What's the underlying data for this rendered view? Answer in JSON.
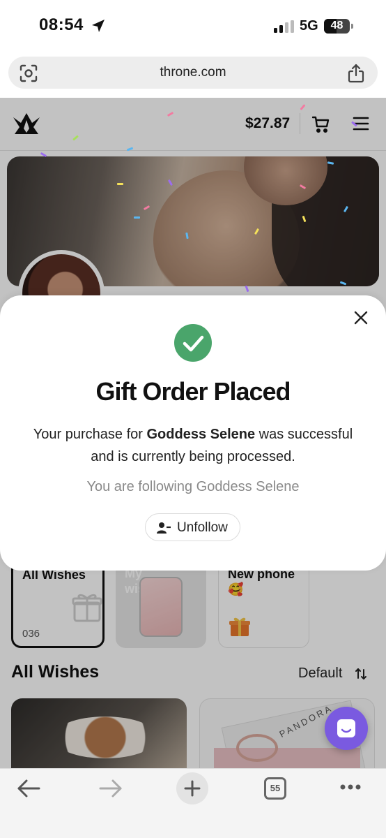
{
  "status_bar": {
    "time": "08:54",
    "network": "5G",
    "battery": "48"
  },
  "browser": {
    "url": "throne.com",
    "tab_count": "55"
  },
  "site_header": {
    "balance": "$27.87"
  },
  "wish_cards": {
    "all_wishes_title": "All Wishes",
    "all_wishes_count": "036",
    "my_wishlist_title": "My wishlist",
    "new_phone_title": "New phone 🥰"
  },
  "wishes_section": {
    "title": "All Wishes",
    "sort_label": "Default"
  },
  "modal": {
    "title": "Gift Order Placed",
    "body_prefix": "Your purchase for ",
    "creator_name": "Goddess Selene",
    "body_suffix": " was successful and is currently being processed.",
    "follow_note": "You are following Goddess Selene",
    "unfollow_label": "Unfollow"
  },
  "colors": {
    "success_green": "#4aa56b",
    "chat_purple": "#7a5ae0"
  },
  "icons": [
    "location-arrow-icon",
    "signal-icon",
    "battery-icon",
    "scan-icon",
    "share-icon",
    "crown-logo-icon",
    "cart-icon",
    "menu-icon",
    "gift-icon",
    "sort-icon",
    "chat-icon",
    "close-icon",
    "check-icon",
    "user-minus-icon",
    "back-icon",
    "forward-icon",
    "plus-icon",
    "tabs-icon",
    "more-icon"
  ]
}
